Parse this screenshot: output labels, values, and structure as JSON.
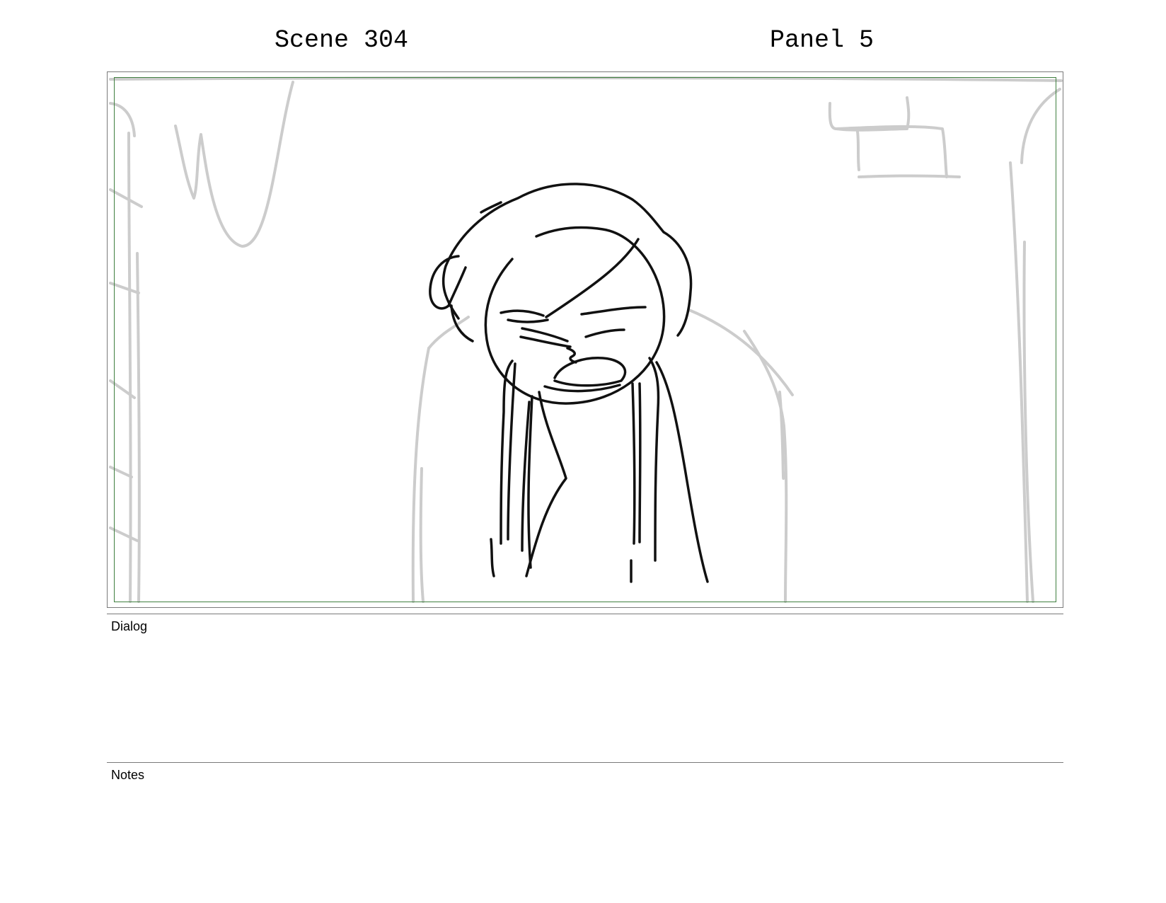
{
  "header": {
    "scene": "Scene 304",
    "panel": "Panel 5"
  },
  "sections": {
    "dialog_label": "Dialog",
    "notes_label": "Notes"
  },
  "colors": {
    "safe_frame": "#3f7f3f",
    "sketch_line": "#111111",
    "background_line": "#cccccc"
  }
}
